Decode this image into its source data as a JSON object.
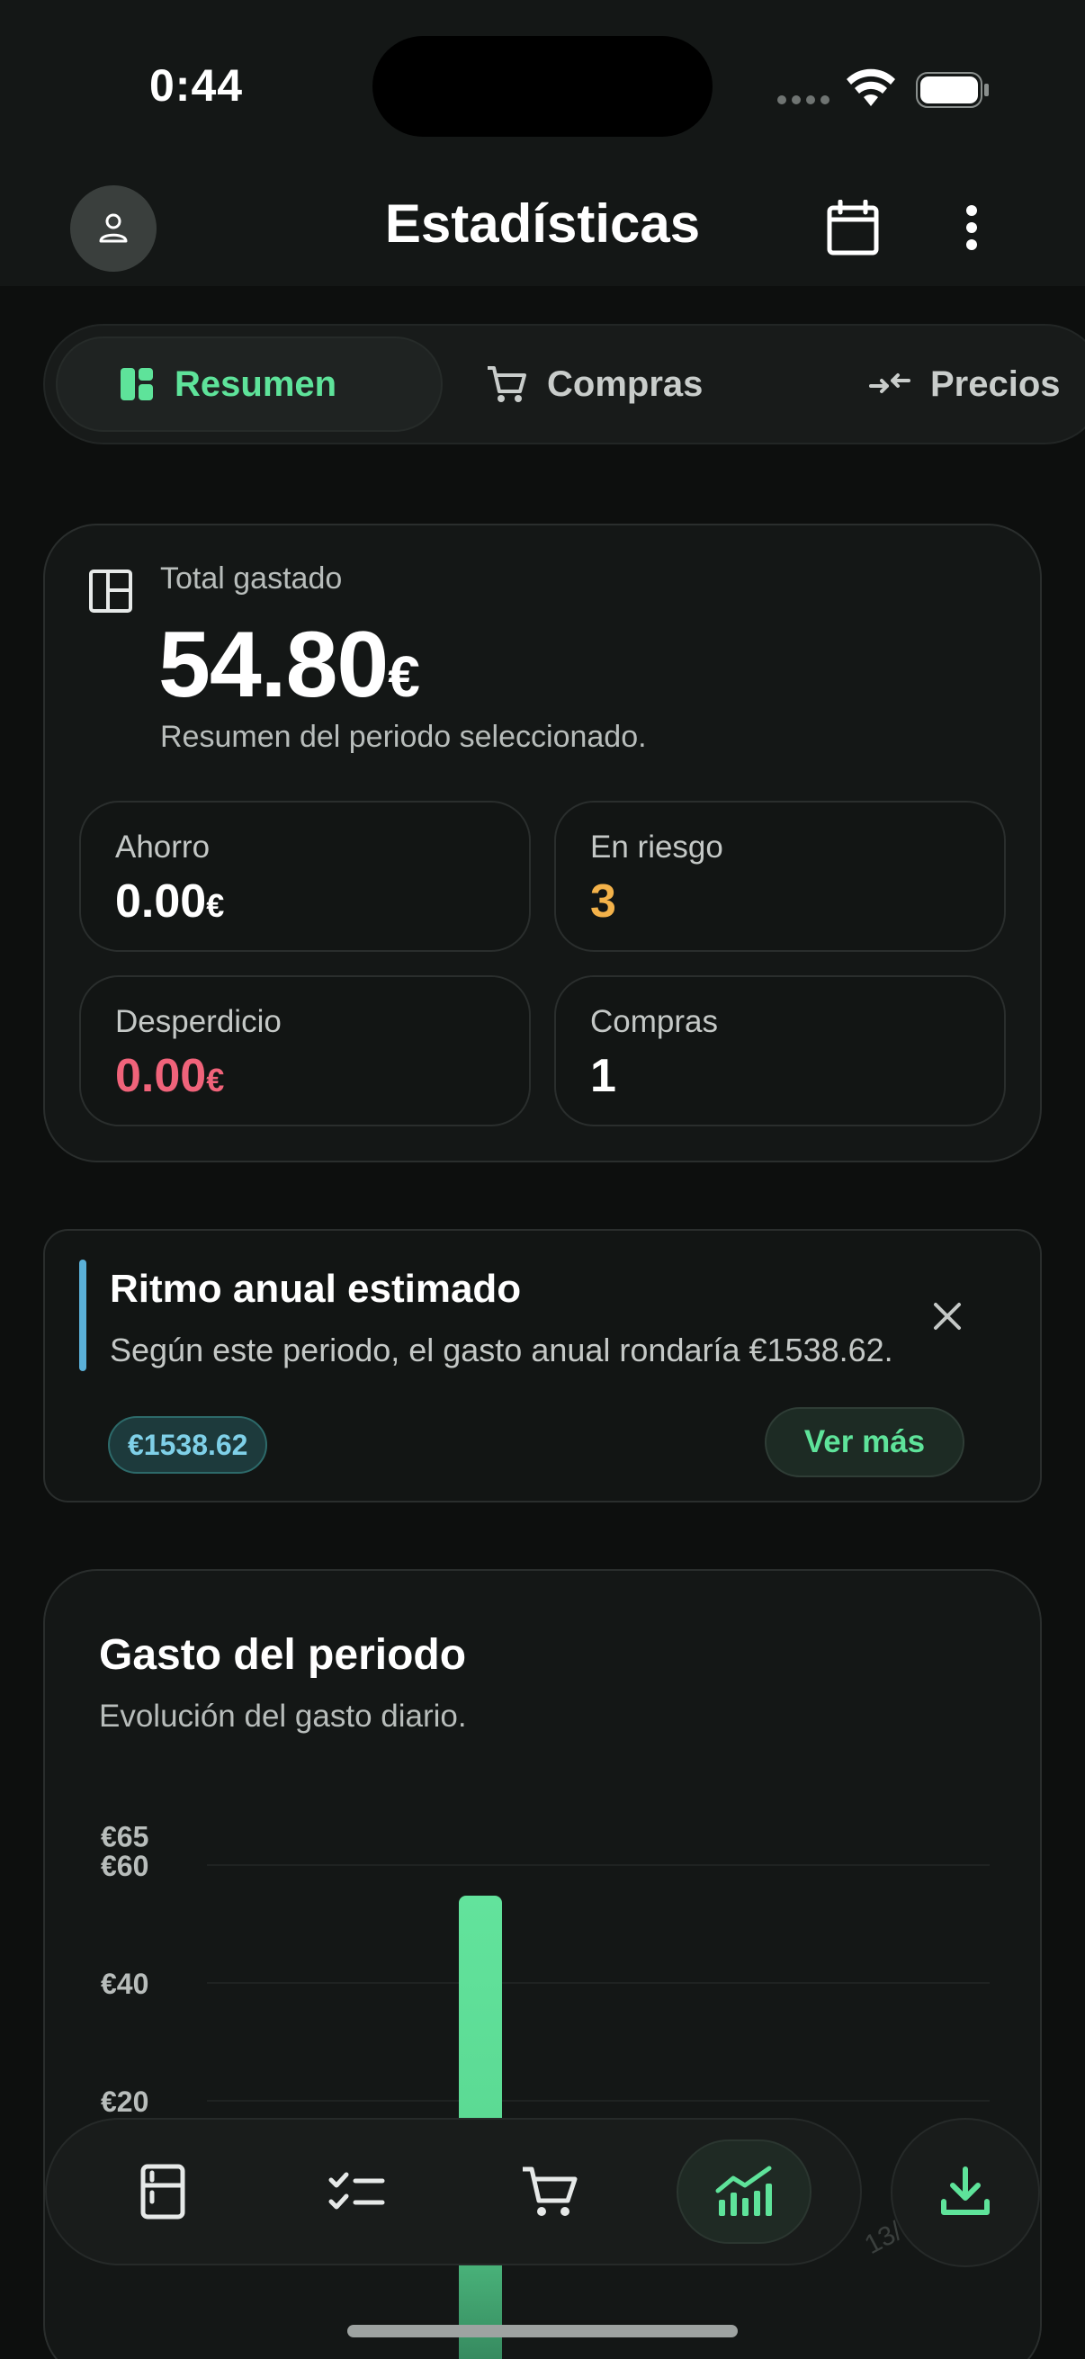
{
  "status_bar": {
    "time": "0:44"
  },
  "header": {
    "title": "Estadísticas"
  },
  "tabs": [
    {
      "label": "Resumen",
      "active": true
    },
    {
      "label": "Compras",
      "active": false
    },
    {
      "label": "Precios",
      "active": false
    }
  ],
  "summary": {
    "total_label": "Total gastado",
    "total_amount": "54.80",
    "total_currency": "€",
    "subtitle": "Resumen del periodo seleccionado.",
    "stats": {
      "ahorro": {
        "label": "Ahorro",
        "amount": "0.00",
        "currency": "€"
      },
      "riesgo": {
        "label": "En riesgo",
        "value": "3"
      },
      "desperdicio": {
        "label": "Desperdicio",
        "amount": "0.00",
        "currency": "€"
      },
      "compras": {
        "label": "Compras",
        "value": "1"
      }
    }
  },
  "ritmo": {
    "title": "Ritmo anual estimado",
    "text": "Según este periodo, el gasto anual rondaría €1538.62.",
    "badge": "€1538.62",
    "button": "Ver más"
  },
  "gasto": {
    "title": "Gasto del periodo",
    "subtitle": "Evolución del gasto diario."
  },
  "chart_data": {
    "type": "bar",
    "title": "Gasto del periodo",
    "y_ticks": [
      "€65",
      "€60",
      "€40",
      "€20"
    ],
    "y_tick_values": [
      65,
      60,
      40,
      20
    ],
    "ylim": [
      0,
      65
    ],
    "values": [
      54.8
    ],
    "x_partial_label": "13/",
    "bar_color": "#5ee39a"
  },
  "colors": {
    "accent": "#5ee39a",
    "warning": "#f3b24a",
    "danger": "#f0637a",
    "info": "#5ab0d8"
  },
  "bottom_nav": {
    "items": [
      "fridge-icon",
      "checklist-icon",
      "cart-icon",
      "chart-icon"
    ],
    "active": "chart-icon",
    "action": "download-icon"
  }
}
